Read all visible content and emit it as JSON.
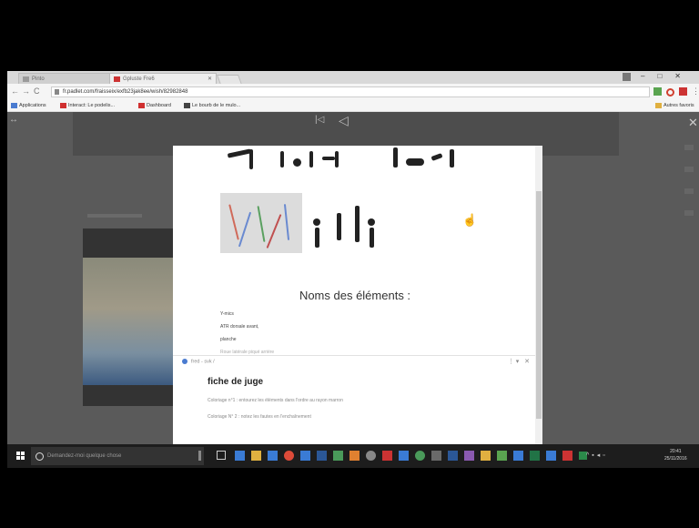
{
  "browser": {
    "tabs": [
      {
        "label": "Pinto"
      },
      {
        "label": "Gpluste Fre6"
      }
    ],
    "url": "fr.padlet.com/fraisseix/exfb23jak8ee/wish/82982848",
    "bookmarks": [
      {
        "label": "Applications",
        "color": "#4a7bd0"
      },
      {
        "label": "Interact: Le podelis...",
        "color": "#d03030"
      },
      {
        "label": "Dashboard",
        "color": "#d03030"
      },
      {
        "label": "Le bourb de le mulo...",
        "color": "#444444"
      }
    ],
    "other_bookmarks": "Autres favoris"
  },
  "modal": {
    "section_title": "Noms des éléments :",
    "element_lines": [
      "Y-mics",
      "ATR dorsale avant,",
      "planche",
      "Roue latérale piqué arrière"
    ],
    "author_meta": "fred - svk /",
    "post_title": "fiche de juge",
    "post_lines": [
      "Coloriage n°1 : entourez les éléments dans l'ordre au rayon marron",
      "Coloriage N° 2 : notez les fautes en l'enchaînement"
    ]
  },
  "taskbar": {
    "search_placeholder": "Demandez-moi quelque chose",
    "clock_time": "20:41",
    "clock_date": "25/11/2016"
  },
  "colors": {
    "taskbar": "#1d1d1d",
    "padlet_bg": "#5a5a5a",
    "modal_bg": "#ffffff"
  }
}
